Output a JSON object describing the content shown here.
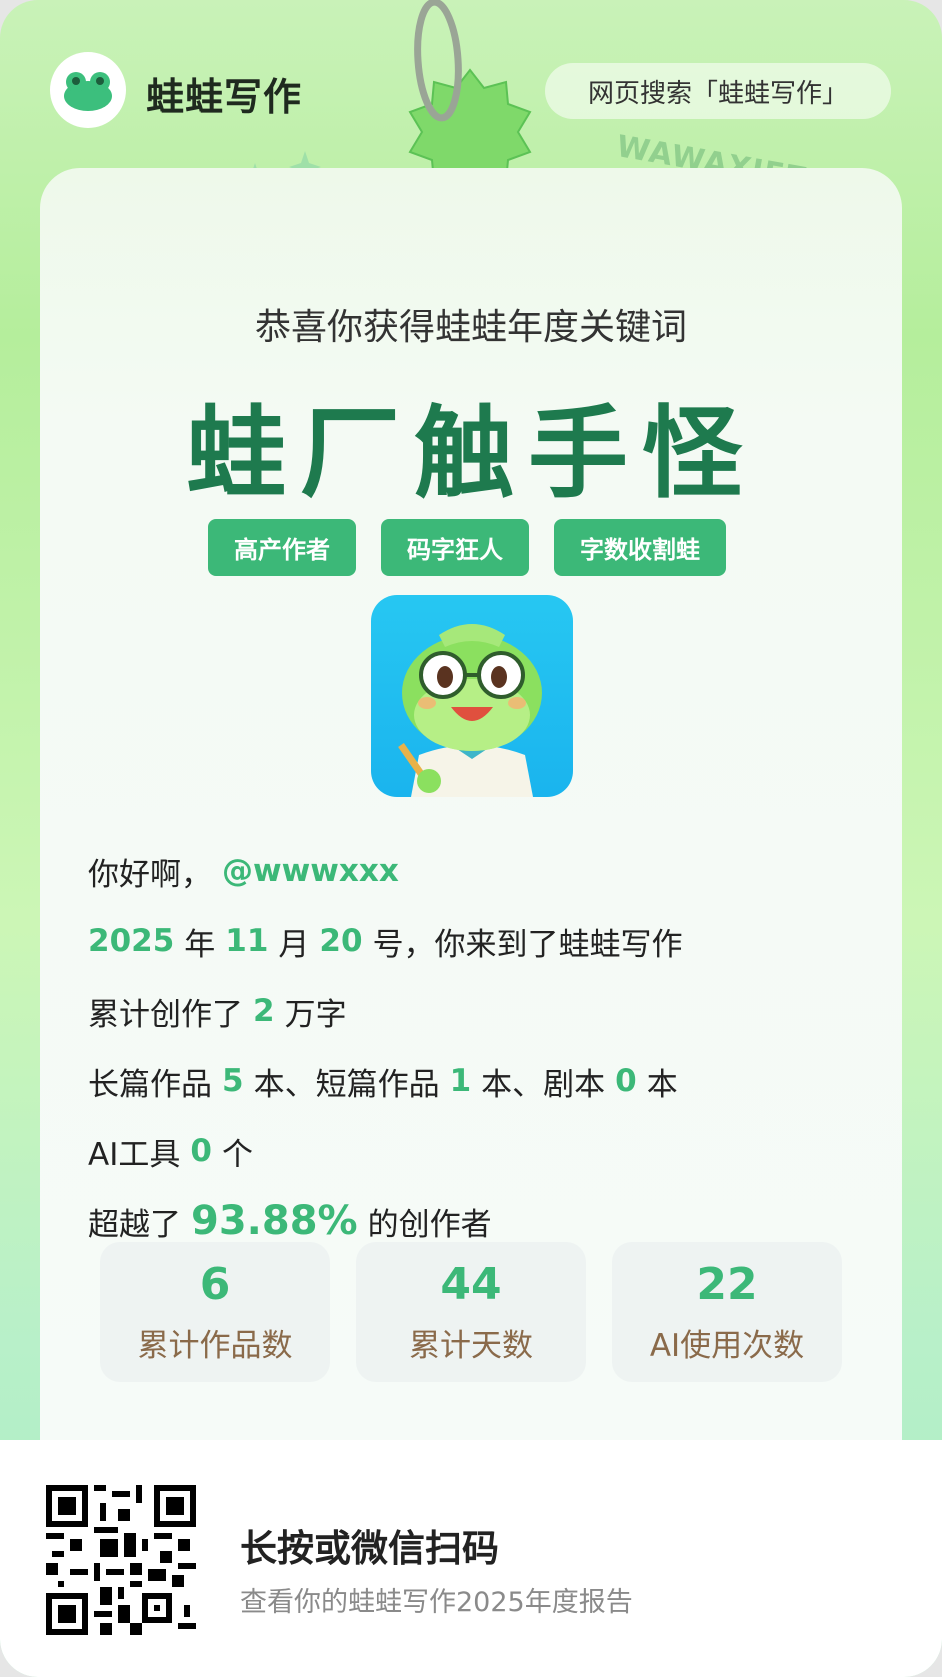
{
  "header": {
    "app_name": "蛙蛙写作",
    "search_hint": "网页搜索「蛙蛙写作」",
    "watermark": "WAWAXIEZUO"
  },
  "main": {
    "congrats": "恭喜你获得蛙蛙年度关键词",
    "keyword": "蛙厂触手怪",
    "tags": [
      "高产作者",
      "码字狂人",
      "字数收割蛙"
    ],
    "greeting": {
      "prefix": "你好啊，",
      "handle": "@wwwxxx"
    },
    "join": {
      "year": "2025",
      "year_unit": "年",
      "month": "11",
      "month_unit": "月",
      "day": "20",
      "suffix": "号，你来到了蛙蛙写作"
    },
    "words": {
      "prefix": "累计创作了",
      "value": "2",
      "suffix": "万字"
    },
    "works": {
      "long_label": "长篇作品",
      "long_value": "5",
      "long_unit": "本、",
      "short_label": "短篇作品",
      "short_value": "1",
      "short_unit": "本、",
      "script_label": "剧本",
      "script_value": "0",
      "script_unit": "本"
    },
    "ai_tools": {
      "prefix": "AI工具",
      "value": "0",
      "suffix": "个"
    },
    "surpass": {
      "prefix": "超越了",
      "value": "93.88%",
      "suffix": "的创作者"
    },
    "stats": [
      {
        "value": "6",
        "label": "累计作品数"
      },
      {
        "value": "44",
        "label": "累计天数"
      },
      {
        "value": "22",
        "label": "AI使用次数"
      }
    ]
  },
  "footer": {
    "title": "长按或微信扫码",
    "subtitle": "查看你的蛙蛙写作2025年度报告"
  },
  "colors": {
    "accent": "#3cb878",
    "keyword": "#1e7a4e",
    "background": "#b5ee9c"
  }
}
